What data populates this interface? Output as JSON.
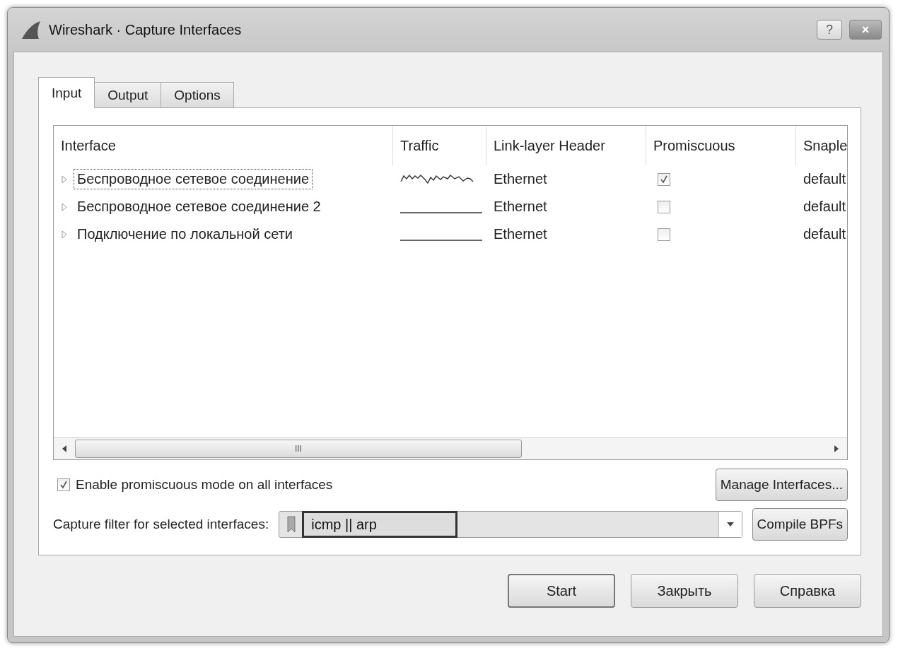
{
  "window": {
    "title": "Wireshark · Capture Interfaces",
    "help_button": "?",
    "close_button": "×"
  },
  "tabs": [
    {
      "label": "Input",
      "selected": true
    },
    {
      "label": "Output",
      "selected": false
    },
    {
      "label": "Options",
      "selected": false
    }
  ],
  "table": {
    "columns": [
      "Interface",
      "Traffic",
      "Link-layer Header",
      "Promiscuous",
      "Snaple"
    ],
    "rows": [
      {
        "interface": "Беспроводное сетевое соединение",
        "traffic_active": true,
        "link_layer": "Ethernet",
        "promiscuous": true,
        "snaplen": "default",
        "selected": true
      },
      {
        "interface": "Беспроводное сетевое соединение 2",
        "traffic_active": false,
        "link_layer": "Ethernet",
        "promiscuous": false,
        "snaplen": "default",
        "selected": false
      },
      {
        "interface": "Подключение по локальной сети",
        "traffic_active": false,
        "link_layer": "Ethernet",
        "promiscuous": false,
        "snaplen": "default",
        "selected": false
      }
    ]
  },
  "scrollbar_grip": "III",
  "promiscuous_all": {
    "label": "Enable promiscuous mode on all interfaces",
    "checked": true
  },
  "manage_button": "Manage Interfaces...",
  "capture_filter": {
    "label": "Capture filter for selected interfaces:",
    "value": "icmp || arp"
  },
  "compile_button": "Compile BPFs",
  "buttons": [
    "Start",
    "Закрыть",
    "Справка"
  ]
}
